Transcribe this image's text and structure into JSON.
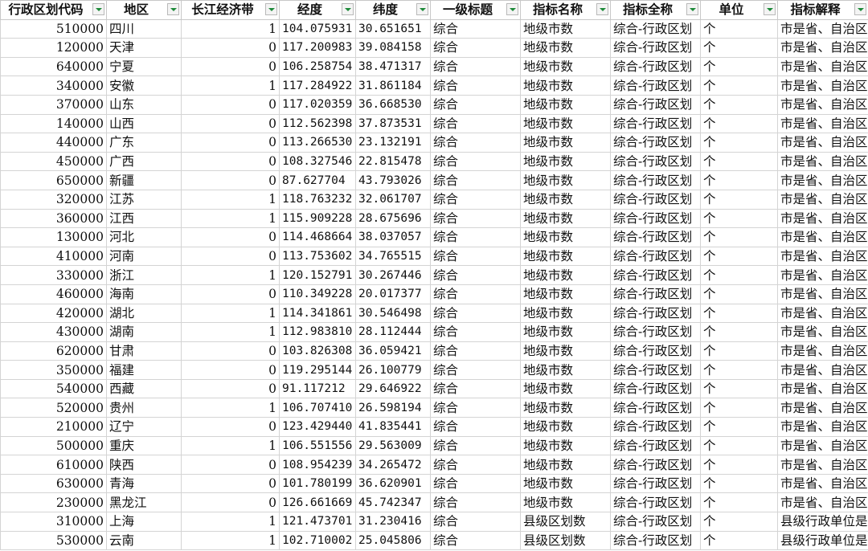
{
  "headers": [
    "行政区划代码",
    "地区",
    "长江经济带",
    "经度",
    "纬度",
    "一级标题",
    "指标名称",
    "指标全称",
    "单位",
    "指标解释"
  ],
  "rows": [
    [
      "510000",
      "四川",
      "1",
      "104.075931",
      "30.651651",
      "综合",
      "地级市数",
      "综合-行政区划",
      "个",
      "市是省、自治区"
    ],
    [
      "120000",
      "天津",
      "0",
      "117.200983",
      "39.084158",
      "综合",
      "地级市数",
      "综合-行政区划",
      "个",
      "市是省、自治区"
    ],
    [
      "640000",
      "宁夏",
      "0",
      "106.258754",
      "38.471317",
      "综合",
      "地级市数",
      "综合-行政区划",
      "个",
      "市是省、自治区"
    ],
    [
      "340000",
      "安徽",
      "1",
      "117.284922",
      "31.861184",
      "综合",
      "地级市数",
      "综合-行政区划",
      "个",
      "市是省、自治区"
    ],
    [
      "370000",
      "山东",
      "0",
      "117.020359",
      "36.668530",
      "综合",
      "地级市数",
      "综合-行政区划",
      "个",
      "市是省、自治区"
    ],
    [
      "140000",
      "山西",
      "0",
      "112.562398",
      "37.873531",
      "综合",
      "地级市数",
      "综合-行政区划",
      "个",
      "市是省、自治区"
    ],
    [
      "440000",
      "广东",
      "0",
      "113.266530",
      "23.132191",
      "综合",
      "地级市数",
      "综合-行政区划",
      "个",
      "市是省、自治区"
    ],
    [
      "450000",
      "广西",
      "0",
      "108.327546",
      "22.815478",
      "综合",
      "地级市数",
      "综合-行政区划",
      "个",
      "市是省、自治区"
    ],
    [
      "650000",
      "新疆",
      "0",
      "87.627704",
      "43.793026",
      "综合",
      "地级市数",
      "综合-行政区划",
      "个",
      "市是省、自治区"
    ],
    [
      "320000",
      "江苏",
      "1",
      "118.763232",
      "32.061707",
      "综合",
      "地级市数",
      "综合-行政区划",
      "个",
      "市是省、自治区"
    ],
    [
      "360000",
      "江西",
      "1",
      "115.909228",
      "28.675696",
      "综合",
      "地级市数",
      "综合-行政区划",
      "个",
      "市是省、自治区"
    ],
    [
      "130000",
      "河北",
      "0",
      "114.468664",
      "38.037057",
      "综合",
      "地级市数",
      "综合-行政区划",
      "个",
      "市是省、自治区"
    ],
    [
      "410000",
      "河南",
      "0",
      "113.753602",
      "34.765515",
      "综合",
      "地级市数",
      "综合-行政区划",
      "个",
      "市是省、自治区"
    ],
    [
      "330000",
      "浙江",
      "1",
      "120.152791",
      "30.267446",
      "综合",
      "地级市数",
      "综合-行政区划",
      "个",
      "市是省、自治区"
    ],
    [
      "460000",
      "海南",
      "0",
      "110.349228",
      "20.017377",
      "综合",
      "地级市数",
      "综合-行政区划",
      "个",
      "市是省、自治区"
    ],
    [
      "420000",
      "湖北",
      "1",
      "114.341861",
      "30.546498",
      "综合",
      "地级市数",
      "综合-行政区划",
      "个",
      "市是省、自治区"
    ],
    [
      "430000",
      "湖南",
      "1",
      "112.983810",
      "28.112444",
      "综合",
      "地级市数",
      "综合-行政区划",
      "个",
      "市是省、自治区"
    ],
    [
      "620000",
      "甘肃",
      "0",
      "103.826308",
      "36.059421",
      "综合",
      "地级市数",
      "综合-行政区划",
      "个",
      "市是省、自治区"
    ],
    [
      "350000",
      "福建",
      "0",
      "119.295144",
      "26.100779",
      "综合",
      "地级市数",
      "综合-行政区划",
      "个",
      "市是省、自治区"
    ],
    [
      "540000",
      "西藏",
      "0",
      "91.117212",
      "29.646922",
      "综合",
      "地级市数",
      "综合-行政区划",
      "个",
      "市是省、自治区"
    ],
    [
      "520000",
      "贵州",
      "1",
      "106.707410",
      "26.598194",
      "综合",
      "地级市数",
      "综合-行政区划",
      "个",
      "市是省、自治区"
    ],
    [
      "210000",
      "辽宁",
      "0",
      "123.429440",
      "41.835441",
      "综合",
      "地级市数",
      "综合-行政区划",
      "个",
      "市是省、自治区"
    ],
    [
      "500000",
      "重庆",
      "1",
      "106.551556",
      "29.563009",
      "综合",
      "地级市数",
      "综合-行政区划",
      "个",
      "市是省、自治区"
    ],
    [
      "610000",
      "陕西",
      "0",
      "108.954239",
      "34.265472",
      "综合",
      "地级市数",
      "综合-行政区划",
      "个",
      "市是省、自治区"
    ],
    [
      "630000",
      "青海",
      "0",
      "101.780199",
      "36.620901",
      "综合",
      "地级市数",
      "综合-行政区划",
      "个",
      "市是省、自治区"
    ],
    [
      "230000",
      "黑龙江",
      "0",
      "126.661669",
      "45.742347",
      "综合",
      "地级市数",
      "综合-行政区划",
      "个",
      "市是省、自治区"
    ],
    [
      "310000",
      "上海",
      "1",
      "121.473701",
      "31.230416",
      "综合",
      "县级区划数",
      "综合-行政区划",
      "个",
      "县级行政单位是"
    ],
    [
      "530000",
      "云南",
      "1",
      "102.710002",
      "25.045806",
      "综合",
      "县级区划数",
      "综合-行政区划",
      "个",
      "县级行政单位是"
    ]
  ]
}
